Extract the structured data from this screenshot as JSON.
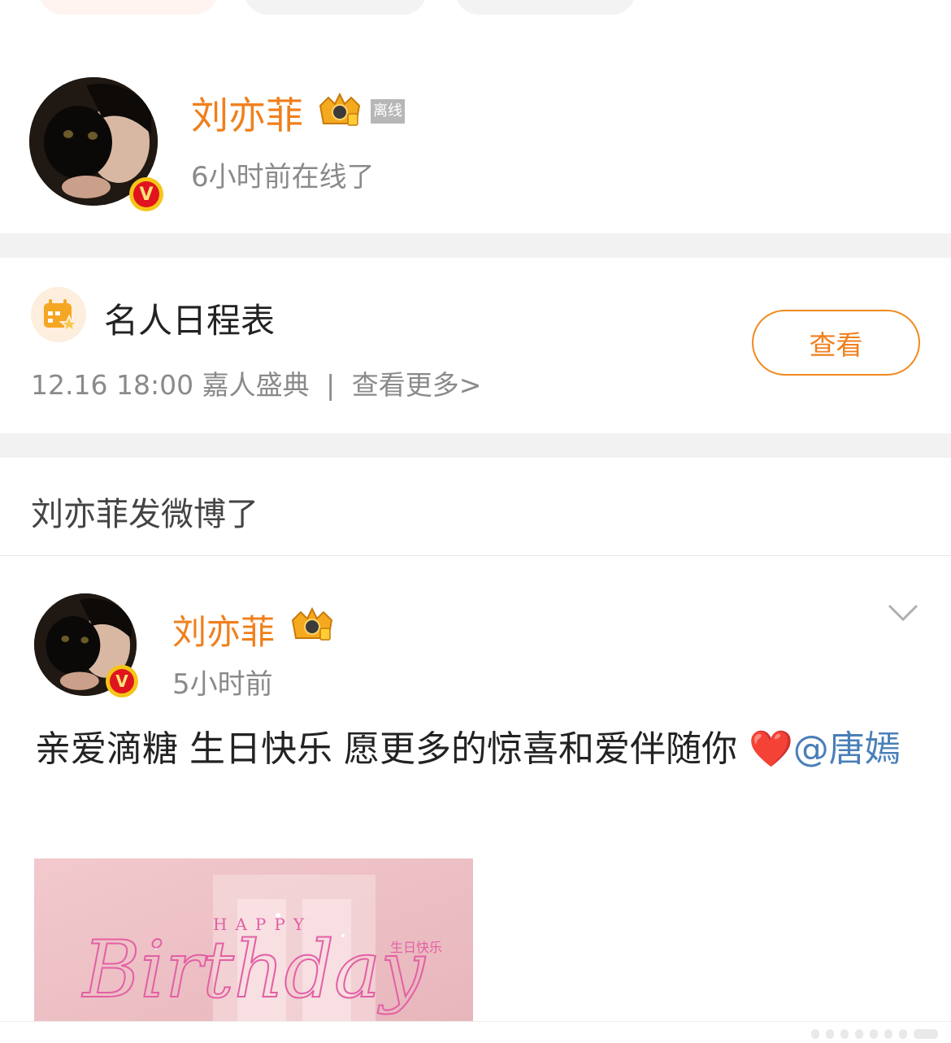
{
  "profile": {
    "name": "刘亦菲",
    "status_badge": "离线",
    "online_text": "6小时前在线了",
    "verified_badge": "V"
  },
  "schedule": {
    "title": "名人日程表",
    "date_time": "12.16 18:00",
    "event": "嘉人盛典",
    "separator": "|",
    "more_link": "查看更多>",
    "view_button": "查看",
    "icon": "calendar-star-icon"
  },
  "feed": {
    "header": "刘亦菲发微博了"
  },
  "post": {
    "author": "刘亦菲",
    "time": "5小时前",
    "verified_badge": "V",
    "text": "亲爱滴糖 生日快乐 愿更多的惊喜和爱伴随你 ",
    "emoji": "❤️",
    "mention": "@唐嫣",
    "image": {
      "line_1": "HAPPY",
      "line_2": "Birthday",
      "line_3": "生日快乐"
    }
  },
  "colors": {
    "accent_orange": "#f07f1b",
    "link_blue": "#4a7fb8",
    "gray_text": "#8a8a8a",
    "separator_gray": "#f2f2f2"
  }
}
